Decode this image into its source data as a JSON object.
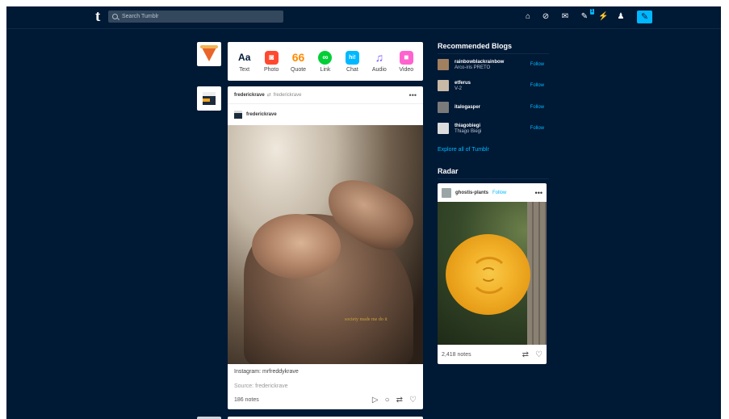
{
  "header": {
    "logo": "t",
    "search_placeholder": "Search Tumblr",
    "nav_icons": [
      "home-icon",
      "explore-icon",
      "mail-icon",
      "inbox-icon",
      "activity-icon",
      "account-icon",
      "compose-icon"
    ],
    "glyphs": {
      "home": "⌂",
      "explore": "⊘",
      "mail": "✉",
      "inbox": "✎",
      "activity": "⚡",
      "account": "♟",
      "compose": "✎"
    },
    "inbox_badge": "1"
  },
  "post_types": [
    {
      "label": "Text",
      "icon": "Aa",
      "color": "#001935"
    },
    {
      "label": "Photo",
      "icon": "◙",
      "color": "#ff492f"
    },
    {
      "label": "Quote",
      "icon": "66",
      "color": "#ff8a00"
    },
    {
      "label": "Link",
      "icon": "∞",
      "color": "#00cf35"
    },
    {
      "label": "Chat",
      "icon": "hi!",
      "color": "#00b8ff"
    },
    {
      "label": "Audio",
      "icon": "♫",
      "color": "#7c5cff"
    },
    {
      "label": "Video",
      "icon": "■",
      "color": "#ff62ce"
    }
  ],
  "post": {
    "author": "frederickrave",
    "reblog_from": "frederickrave",
    "sub_author": "frederickrave",
    "more": "•••",
    "photo_caption": "society made me do it",
    "text": "Instagram: mrfreddykrave",
    "source": "Source: frederickrave",
    "notes": "186 notes",
    "actions": [
      "▷",
      "○",
      "⇄",
      "♡"
    ]
  },
  "sidebar": {
    "recommended_title": "Recommended Blogs",
    "blogs": [
      {
        "name": "rainbowblackrainbow",
        "desc": "Arco-iris PRETO",
        "follow": "Follow",
        "color": "#a0805e"
      },
      {
        "name": "etferus",
        "desc": "V-2",
        "follow": "Follow",
        "color": "#c7b9a6"
      },
      {
        "name": "italogasper",
        "desc": "",
        "follow": "Follow",
        "color": "#7a7a7a"
      },
      {
        "name": "thiagobiegi",
        "desc": "Thiago Biegi",
        "follow": "Follow",
        "color": "#dddddd"
      }
    ],
    "explore_link": "Explore all of Tumblr",
    "radar_title": "Radar",
    "radar": {
      "author": "ghostis-plants",
      "follow": "Follow",
      "more": "•••",
      "notes": "2,418 notes",
      "actions": [
        "⇄",
        "♡"
      ]
    }
  }
}
